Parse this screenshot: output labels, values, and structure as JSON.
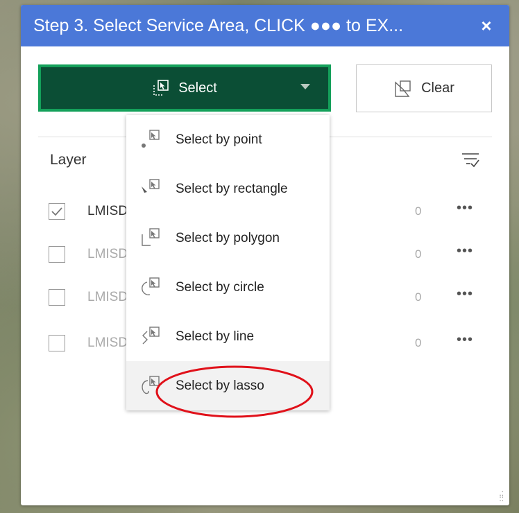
{
  "header": {
    "title": "Step 3. Select Service Area, CLICK ●●● to EX...",
    "close_label": "×"
  },
  "toolbar": {
    "select_label": "Select",
    "clear_label": "Clear"
  },
  "layer_heading": "Layer",
  "layers": [
    {
      "name": "LMISD",
      "count": "0",
      "checked": true,
      "more": "•••"
    },
    {
      "name": "LMISD",
      "count": "0",
      "checked": false,
      "more": "•••"
    },
    {
      "name": "LMISD",
      "count": "0",
      "checked": false,
      "more": "•••"
    },
    {
      "name": "LMISD",
      "count": "0",
      "checked": false,
      "more": "•••"
    }
  ],
  "dropdown": {
    "items": [
      {
        "label": "Select by point",
        "icon": "select-point-icon"
      },
      {
        "label": "Select by rectangle",
        "icon": "select-rectangle-icon"
      },
      {
        "label": "Select by polygon",
        "icon": "select-polygon-icon"
      },
      {
        "label": "Select by circle",
        "icon": "select-circle-icon"
      },
      {
        "label": "Select by line",
        "icon": "select-line-icon"
      },
      {
        "label": "Select by lasso",
        "icon": "select-lasso-icon"
      }
    ],
    "highlighted": "Select by lasso"
  },
  "colors": {
    "header": "#4b78d8",
    "select_button": "#0b4e35",
    "select_border": "#14a05a",
    "annotation": "#e0111a"
  }
}
